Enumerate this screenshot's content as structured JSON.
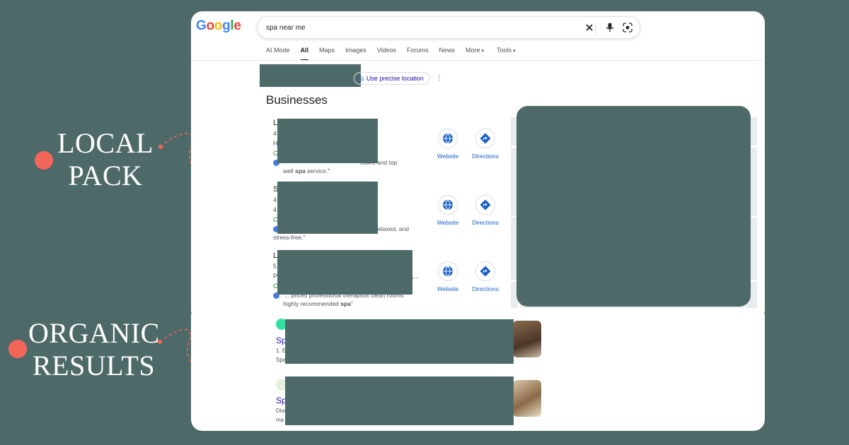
{
  "annotations": {
    "local_pack": [
      "LOCAL",
      "PACK"
    ],
    "organic_results": [
      "ORGANIC",
      "RESULTS"
    ]
  },
  "logo": {
    "letters": [
      "G",
      "o",
      "o",
      "g",
      "l",
      "e"
    ],
    "colors": [
      "#4285f4",
      "#ea4335",
      "#fbbc05",
      "#4285f4",
      "#34a853",
      "#ea4335"
    ]
  },
  "search": {
    "query": "spa near me",
    "clear_icon": "close-icon",
    "voice_icon": "mic-icon",
    "lens_icon": "camera-lens-icon"
  },
  "tabs": [
    {
      "label": "AI Mode",
      "active": false
    },
    {
      "label": "All",
      "active": true
    },
    {
      "label": "Maps",
      "active": false
    },
    {
      "label": "Images",
      "active": false
    },
    {
      "label": "Videos",
      "active": false
    },
    {
      "label": "Forums",
      "active": false
    },
    {
      "label": "News",
      "active": false
    },
    {
      "label": "More",
      "active": false,
      "dropdown": true
    },
    {
      "label": "Tools",
      "active": false,
      "dropdown": true
    }
  ],
  "location": {
    "button_label": "Use precise location"
  },
  "businesses": {
    "title": "Businesses",
    "listings": [
      {
        "name_initial": "L",
        "rating_stub": "4",
        "info_stub": "H",
        "status_stub": "C",
        "review_end": "room, and top",
        "review_line2_pre": "well ",
        "review_line2_bold": "spa",
        "review_line2_post": " service.\""
      },
      {
        "name_initial": "S",
        "rating_stub": "4",
        "info_stub": "4",
        "status_stub": "C",
        "review_end": "ed, relaxed, and",
        "review_line2_pre": "stress-free.\"",
        "review_line2_bold": "",
        "review_line2_post": ""
      },
      {
        "name_initial": "L",
        "rating_stub": "5",
        "info_stub": "P",
        "info_end": "i,...",
        "status_stub": "C",
        "review_end": "\"... prices professional therapists clean rooms",
        "review_line2_pre": "highly recommended ",
        "review_line2_bold": "spa",
        "review_line2_post": "\""
      }
    ],
    "actions": {
      "website_label": "Website",
      "directions_label": "Directions"
    }
  },
  "organic": [
    {
      "title_stub": "Sp",
      "line1": "1. E",
      "line2": "Spa"
    },
    {
      "title_stub": "Sp",
      "line1": "Disc",
      "line2": "ma"
    }
  ],
  "colors": {
    "accent": "#1a5fc9",
    "link": "#1a0dab",
    "redaction": "#4e6a68",
    "marker": "#f2665a"
  }
}
